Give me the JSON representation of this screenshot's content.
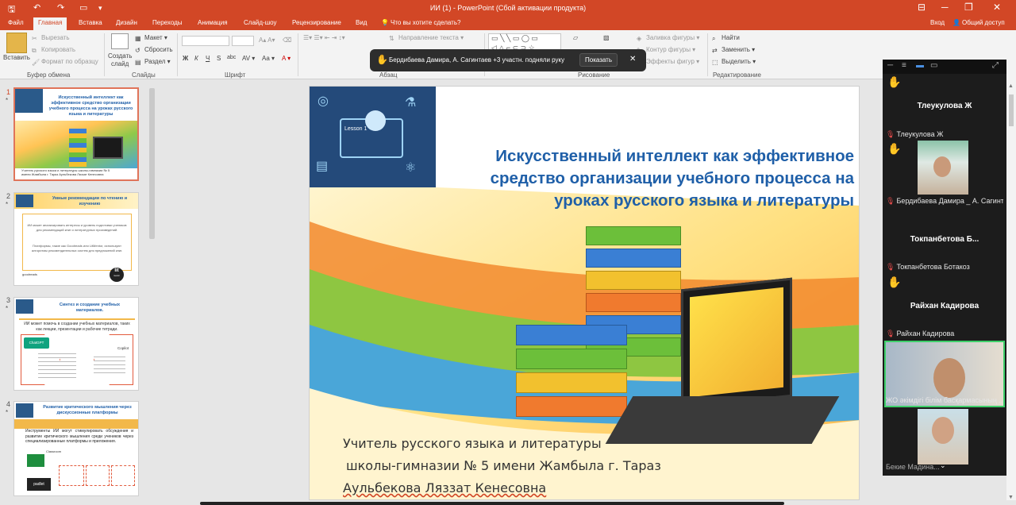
{
  "window": {
    "title": "ИИ (1) - PowerPoint (Сбой активации продукта)",
    "close": "✕",
    "restore": "❐",
    "minimize": "─",
    "layout": "⊟"
  },
  "ribbon_tabs": [
    {
      "label": "Файл"
    },
    {
      "label": "Главная"
    },
    {
      "label": "Вставка"
    },
    {
      "label": "Дизайн"
    },
    {
      "label": "Переходы"
    },
    {
      "label": "Анимация"
    },
    {
      "label": "Слайд-шоу"
    },
    {
      "label": "Рецензирование"
    },
    {
      "label": "Вид"
    },
    {
      "label": "Что вы хотите сделать?"
    }
  ],
  "account": {
    "login": "Вход",
    "share": "Общий доступ"
  },
  "ribbon": {
    "clipboard": {
      "paste": "Вставить",
      "cut": "Вырезать",
      "copy": "Копировать",
      "format": "Формат по образцу",
      "group": "Буфер обмена"
    },
    "slides": {
      "new": "Создать",
      "new2": "слайд",
      "layout": "Макет",
      "reset": "Сбросить",
      "section": "Раздел",
      "group": "Слайды"
    },
    "font": {
      "group": "Шрифт",
      "bold": "Ж",
      "italic": "К",
      "under": "Ч",
      "strike": "S",
      "abc": "abc"
    },
    "paragraph": {
      "direction": "Направление текста",
      "group": "Абзац"
    },
    "drawing": {
      "fill": "Заливка фигуры",
      "outline": "Контур фигуры",
      "effects": "Эффекты фигур",
      "group": "Рисование"
    },
    "editing": {
      "find": "Найти",
      "replace": "Заменить",
      "select": "Выделить",
      "group": "Редактирование"
    }
  },
  "notification": {
    "text": "Бердибаева Дамира, А. Сагинтаев +3 участн. подняли руку",
    "action": "Показать",
    "close": "✕"
  },
  "thumbnails": [
    {
      "num": "1",
      "star": "*",
      "title": "Искусственный интеллект как эффективное средство организации учебного процесса на уроках русского языка и литературы",
      "footer": "Учитель русского языка и литературы школы-гимназии № 5 имени Жамбыла г. Тараз Аульбекова Ляззат Кенесовна"
    },
    {
      "num": "2",
      "star": "*",
      "title": "Умные рекомендации по чтению и изучению",
      "body": "ИИ может анализировать интересы и уровень подготовки учеников для рекомендаций книг и литературных произведений.",
      "body2": "Платформы, такие как Goodreads или LitMentor, используют алгоритмы рекомендательных систем для предложений книг.",
      "logo": "lit",
      "logo2": "mentor",
      "brand": "goodreads"
    },
    {
      "num": "3",
      "star": "*",
      "title": "Синтез и создание учебных материалов.",
      "body": "ИИ может помочь в создании учебных материалов, таких как лекции, презентации и рабочие тетради.",
      "chatgpt": "ChatGPT",
      "copilot": "Copilot"
    },
    {
      "num": "4",
      "star": "*",
      "title": "Развитие критического мышления через дискуссионные платформы",
      "body": "Инструменты ИИ могут стимулировать обсуждения и развитие критического мышления среди учеников через специализированные платформы и приложения.",
      "classroom": "Classroom",
      "padlet": "padlet"
    }
  ],
  "slide": {
    "badge": "Lesson 1",
    "title": "Искусственный интеллект как эффективное средство организации учебного процесса на уроках русского языка и литературы",
    "line1": "Учитель русского языка и литературы",
    "line2": "школы-гимназии № 5 имени Жамбыла г. Тараз",
    "line3": "Аульбекова Ляззат Кенесовна"
  },
  "zoom": {
    "participants": [
      {
        "name": "Тлеукулова Ж",
        "label": "Тлеукулова Ж",
        "hand": true,
        "video": false
      },
      {
        "name": "",
        "label": "Бердибаева Дамира _ А. Сагинт...",
        "hand": true,
        "video": true
      },
      {
        "name": "Токпанбетова  Б...",
        "label": "Токпанбетова Ботакоз",
        "hand": true,
        "video": false
      },
      {
        "name": "Райхан Кадирова",
        "label": "Райхан Кадирова",
        "hand": true,
        "video": false
      },
      {
        "name": "",
        "label": "ЖО әкімдігі білім басқармасының ...",
        "hand": false,
        "video": true
      },
      {
        "name": "",
        "label": "Бекие Мадина...",
        "hand": false,
        "video": true
      }
    ]
  },
  "colors": {
    "accent": "#d24726",
    "title_blue": "#1f5fa8",
    "hand": "#f4c022",
    "mic": "#e84c4c"
  }
}
